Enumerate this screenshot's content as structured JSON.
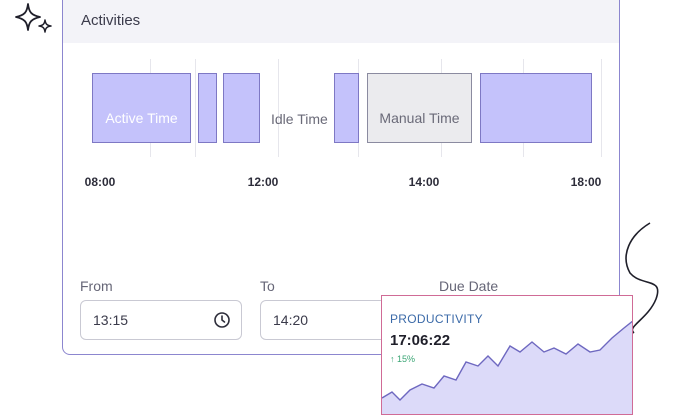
{
  "card": {
    "title": "Activities"
  },
  "timeline": {
    "blocks": [
      {
        "kind": "active",
        "label": "Active Time"
      },
      {
        "kind": "active",
        "label": ""
      },
      {
        "kind": "active",
        "label": ""
      },
      {
        "kind": "idle",
        "label": "Idle Time"
      },
      {
        "kind": "active",
        "label": ""
      },
      {
        "kind": "manual",
        "label": "Manual Time"
      },
      {
        "kind": "active",
        "label": ""
      }
    ],
    "ticks": [
      "08:00",
      "12:00",
      "14:00",
      "18:00"
    ]
  },
  "form": {
    "from_label": "From",
    "from_value": "13:15",
    "to_label": "To",
    "to_value": "14:20",
    "due_label": "Due Date"
  },
  "productivity": {
    "title": "PRODUCTIVITY",
    "time": "17:06:22",
    "delta": "↑ 15%"
  },
  "colors": {
    "active_fill": "#c4c2fb",
    "manual_fill": "#ebebee",
    "card_border": "#8c86cf",
    "productivity_border": "#d06b96",
    "delta_green": "#3aa574"
  }
}
